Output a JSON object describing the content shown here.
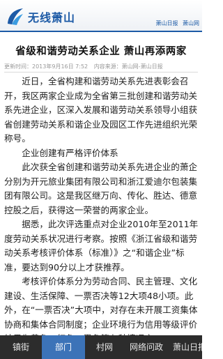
{
  "header": {
    "app_title": "无线萧山",
    "links": [
      "萧山日报",
      "萧山网"
    ]
  },
  "article": {
    "title": "省级和谐劳动关系企业 萧山再添两家",
    "meta": {
      "updated": "更新时间：2013年9月16日 7:52",
      "source": "内容来源：萧山网-萧山日报"
    },
    "paragraphs": [
      "近日，全省构建和谐劳动关系先进表彰会召开，我区两家企业成为全省第三批创建和谐劳动关系先进企业，区深入发展和谐劳动关系领导小组获省创建劳动关系和谐企业及园区工作先进组织光荣称号。",
      "企业创建有严格评价体系",
      "此次获全省创建和谐劳动关系先进企业的萧企分别为开元旅业集团有限公司和浙江爱迪尔包装集团有限公司。这是我区继万向、传化、胜达、德意控股之后，获得这一荣誉的两家企业。",
      "据悉，此次评选重点对企业2010年至2011年度劳动关系状况进行考察。按照《浙江省级和谐劳动关系考核评价体系（标准）》之“和谐企业”标准，要达到90分以上才获推荐。",
      "考核评价体系分为劳动合同、民主管理、文化建设、生活保障、一票否决等12大项48小项。此外，在“一票否决”大项中，对存在未开展工资集体协商和集体合同制度；企业环境行为信用等级评价结果为黄色、红色、黑色等七种情况之一，"
    ]
  },
  "tabbar": {
    "tabs": [
      "镇街",
      "部门",
      "村网",
      "网络问政",
      "萧山日报"
    ],
    "active_index": 1
  },
  "colors": {
    "brand": "#1c5aa6",
    "tab_active": "#3c73b8",
    "tabbar_bg": "#2c2c2c"
  }
}
